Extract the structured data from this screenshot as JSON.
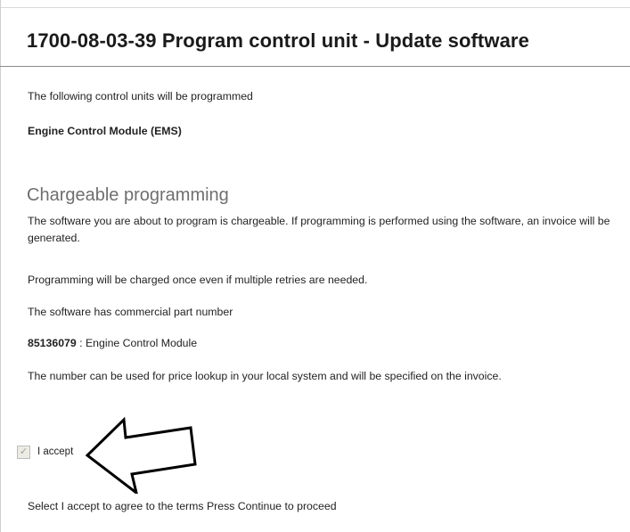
{
  "header": {
    "title": "1700-08-03-39 Program control unit - Update software"
  },
  "intro": {
    "text": "The following control units will be programmed",
    "unit_name": "Engine Control Module (EMS)"
  },
  "chargeable": {
    "heading": "Chargeable programming",
    "paragraph1": "The software you are about to program is chargeable. If programming is performed using the software, an invoice will be generated.",
    "paragraph2": "Programming will be charged once even if multiple retries are needed.",
    "paragraph3": "The software has commercial part number",
    "part_number": "85136079",
    "part_description": " : Engine Control Module",
    "paragraph4": "The number can be used for price lookup in your local system and will be specified on the invoice."
  },
  "accept": {
    "checked": true,
    "check_glyph": "✓",
    "label": "I accept"
  },
  "footer": {
    "instruction": "Select I accept to agree to the terms Press Continue to proceed"
  },
  "annotation": {
    "icon": "arrow-left-icon",
    "stroke_color": "#000000",
    "fill_color": "#ffffff"
  }
}
